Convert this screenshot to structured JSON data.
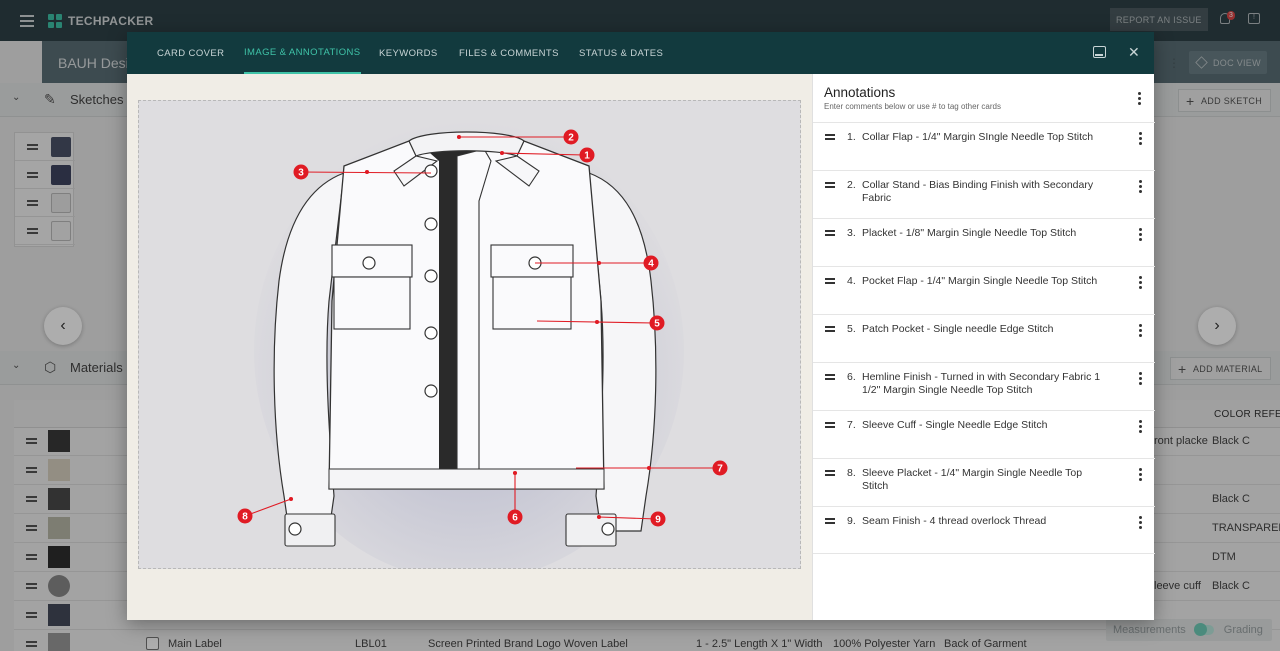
{
  "app": {
    "name": "TECHPACKER",
    "report_label": "REPORT AN ISSUE",
    "notification_count": "3"
  },
  "page": {
    "title": "BAUH Desi",
    "doc_view_label": "DOC VIEW"
  },
  "sections": {
    "sketches": {
      "title": "Sketches",
      "add_label": "ADD SKETCH"
    },
    "materials": {
      "title": "Materials",
      "add_label": "ADD MATERIAL"
    }
  },
  "materials_table": {
    "color_header": "COLOR REFER",
    "rows": [
      {
        "fragment": "ront placke",
        "color": "Black C"
      },
      {
        "fragment": "",
        "color": ""
      },
      {
        "fragment": "",
        "color": "Black C"
      },
      {
        "fragment": "",
        "color": "TRANSPAREN"
      },
      {
        "fragment": "",
        "color": "DTM"
      },
      {
        "fragment": "leeve cuff",
        "color": "Black C"
      },
      {
        "fragment": "",
        "color": ""
      }
    ],
    "last_row": {
      "name": "Main Label",
      "code": "LBL01",
      "description": "Screen Printed Brand Logo Woven Label",
      "size": "1 - 2.5\" Length X 1\" Width",
      "content": "100% Polyester Yarn",
      "placement": "Back of Garment"
    }
  },
  "toggle": {
    "left_label": "Measurements",
    "right_label": "Grading"
  },
  "modal": {
    "tabs": [
      "CARD COVER",
      "IMAGE & ANNOTATIONS",
      "KEYWORDS",
      "FILES & COMMENTS",
      "STATUS & DATES"
    ],
    "active_tab": "IMAGE & ANNOTATIONS",
    "annotations": {
      "title": "Annotations",
      "subtitle": "Enter comments below or use # to tag other cards",
      "items": [
        {
          "num": "1.",
          "text": "Collar Flap - 1/4\" Margin SIngle Needle Top Stitch"
        },
        {
          "num": "2.",
          "text": "Collar Stand - Bias Binding Finish with Secondary Fabric"
        },
        {
          "num": "3.",
          "text": "Placket - 1/8\" Margin Single Needle Top Stitch"
        },
        {
          "num": "4.",
          "text": "Pocket Flap - 1/4\" Margin Single Needle Top Stitch"
        },
        {
          "num": "5.",
          "text": "Patch Pocket - Single needle Edge Stitch"
        },
        {
          "num": "6.",
          "text": "Hemline Finish - Turned in with Secondary Fabric 1 1/2\" Margin Single Needle Top Stitch"
        },
        {
          "num": "7.",
          "text": "Sleeve Cuff - Single Needle Edge Stitch"
        },
        {
          "num": "8.",
          "text": "Sleeve Placket - 1/4\" Margin Single Needle Top Stitch"
        },
        {
          "num": "9.",
          "text": "Seam Finish - 4 thread overlock Thread"
        }
      ]
    },
    "markers": [
      "1",
      "2",
      "3",
      "4",
      "5",
      "6",
      "7",
      "8",
      "9"
    ]
  },
  "colors": {
    "accent": "#3fc3a8",
    "header_bg": "#2f4248",
    "modal_tab_bg": "#123a3e",
    "marker_red": "#e01b24"
  }
}
